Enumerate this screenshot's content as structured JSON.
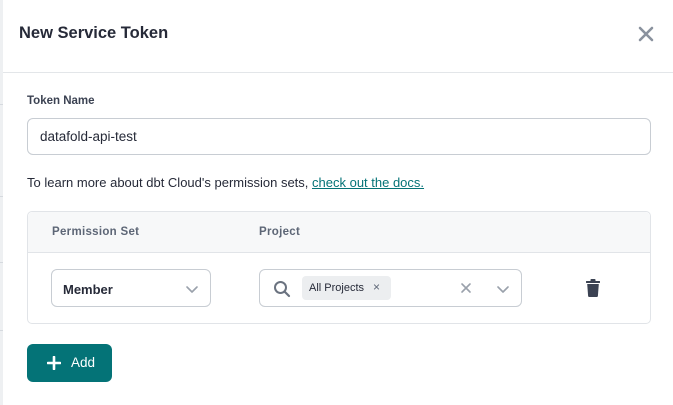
{
  "modal": {
    "title": "New Service Token",
    "close_icon": "close-icon"
  },
  "token": {
    "label": "Token Name",
    "value": "datafold-api-test"
  },
  "help": {
    "text": "To learn more about dbt Cloud's permission sets, ",
    "link": "check out the docs."
  },
  "permissions": {
    "columns": [
      "Permission Set",
      "Project"
    ],
    "rows": [
      {
        "permission_set": "Member",
        "projects": [
          "All Projects"
        ],
        "chip_remove": "×"
      }
    ]
  },
  "add_button": {
    "label": "Add",
    "icon": "plus-icon"
  },
  "colors": {
    "accent": "#047377",
    "border": "#c8cdd3",
    "text": "#262a38"
  }
}
